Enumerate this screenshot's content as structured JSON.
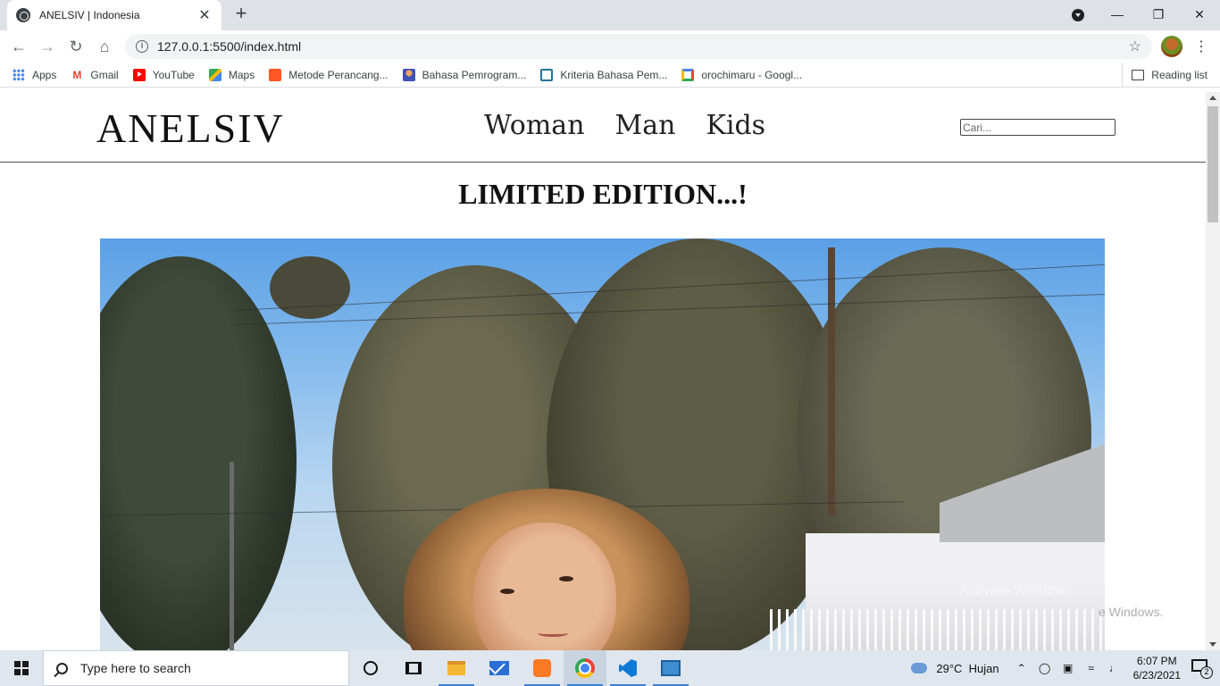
{
  "browser": {
    "tab_title": "ANELSIV | Indonesia",
    "tab_close": "✕",
    "new_tab": "+",
    "url": "127.0.0.1:5500/index.html",
    "window_controls": {
      "minimize": "—",
      "restore": "❐",
      "close": "✕"
    },
    "bookmarks": [
      {
        "label": "Apps",
        "icon": "apps-grid-icon"
      },
      {
        "label": "Gmail",
        "icon": "gmail-icon"
      },
      {
        "label": "YouTube",
        "icon": "youtube-icon"
      },
      {
        "label": "Maps",
        "icon": "maps-icon"
      },
      {
        "label": "Metode Perancang...",
        "icon": "blogger-icon"
      },
      {
        "label": "Bahasa Pemrogram...",
        "icon": "bahasa-icon"
      },
      {
        "label": "Kriteria Bahasa Pem...",
        "icon": "wordpress-icon"
      },
      {
        "label": "orochimaru - Googl...",
        "icon": "google-icon"
      }
    ],
    "reading_list": "Reading list"
  },
  "site": {
    "logo": "ANELSIV",
    "nav": [
      "Woman",
      "Man",
      "Kids"
    ],
    "search_placeholder": "Cari...",
    "headline": "LIMITED EDITION...!"
  },
  "watermark": {
    "line1": "Activate Windows",
    "line2": "e Windows."
  },
  "taskbar": {
    "search_placeholder": "Type here to search",
    "weather_temp": "29°C",
    "weather_text": "Hujan",
    "time": "6:07 PM",
    "date": "6/23/2021",
    "notification_count": "2"
  }
}
